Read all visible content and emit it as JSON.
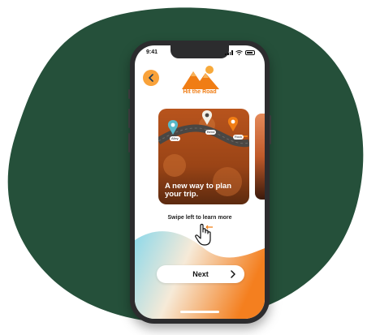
{
  "status_bar": {
    "time": "9:41"
  },
  "app": {
    "logo_text": "Hit the Road"
  },
  "card": {
    "title": "A new way to plan your trip.",
    "pin_labels": [
      "Alley",
      "Bend",
      "Rock"
    ]
  },
  "instructions": {
    "swipe_text": "Swipe left to learn more"
  },
  "buttons": {
    "next_label": "Next"
  },
  "colors": {
    "background_blob": "#25503a",
    "accent_orange": "#f07d14",
    "back_button": "#f9a23a",
    "pin_teal": "#58b9c9",
    "pin_white": "#f3f0e6",
    "gradient_start": "#8cd8ea",
    "gradient_end": "#f47f1f"
  },
  "icons": {
    "back": "chevron-left-icon",
    "logo": "mountains-sun-icon",
    "hand": "swipe-hand-icon",
    "next": "chevron-right-icon"
  }
}
